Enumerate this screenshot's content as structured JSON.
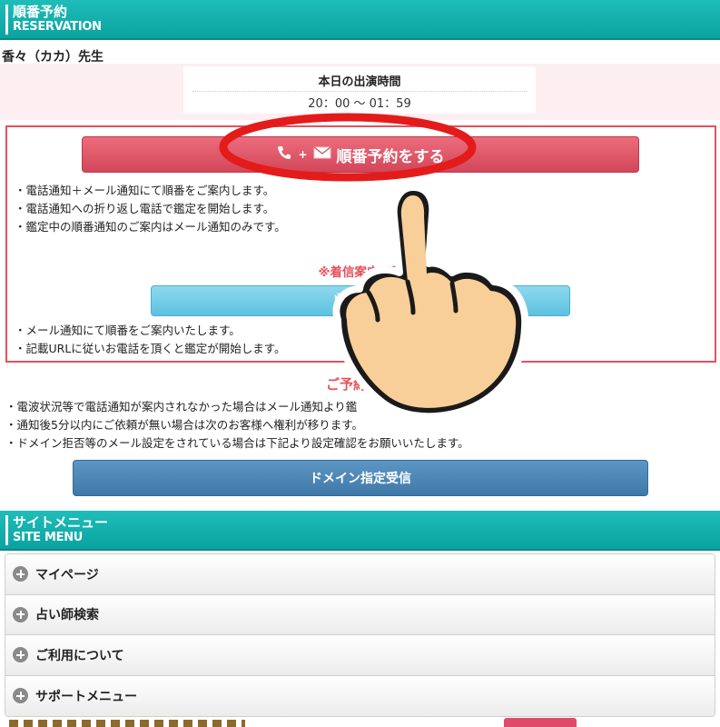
{
  "reservation": {
    "header_jp": "順番予約",
    "header_en": "RESERVATION",
    "teacher_name": "香々（カカ）先生",
    "schedule_title": "本日の出演時間",
    "schedule_time": "20：00 ～ 01：59",
    "phone_button_label": "順番予約をする",
    "phone_notes": [
      "・電話通知＋メール通知にて順番をご案内します。",
      "・電話通知への折り返し電話で鑑定を開始します。",
      "・鑑定中の順番通知のご案内はメール通知のみです。"
    ],
    "warning": "※着信案内不要",
    "mail_button_label": "順番",
    "mail_notes": [
      "・メール通知にて順番をご案内いたします。",
      "・記載URLに従いお電話を頂くと鑑定が開始します。"
    ]
  },
  "caution": {
    "title": "ご予約時の",
    "notes": [
      "・電波状況等で電話通知が案内されなかった場合はメール通知より鑑",
      "・通知後5分以内にご依頼が無い場合は次のお客様へ権利が移ります。",
      "・ドメイン拒否等のメール設定をされている場合は下記より設定確認をお願いいたします。"
    ],
    "domain_button_label": "ドメイン指定受信"
  },
  "site_menu": {
    "header_jp": "サイトメニュー",
    "header_en": "SITE MENU",
    "items": [
      {
        "label": "マイページ"
      },
      {
        "label": "占い師検索"
      },
      {
        "label": "ご利用について"
      },
      {
        "label": "サポートメニュー"
      }
    ]
  },
  "icons": {
    "phone_button": [
      "phone-icon",
      "mail-icon"
    ],
    "mail_button": "mail-icon",
    "menu_items": "plus-circle-icon",
    "overlay": [
      "highlight-circle",
      "pointing-hand"
    ]
  },
  "colors": {
    "header_teal": "#0aa3a0",
    "phone_button": "#d3475a",
    "mail_button": "#5dc2e0",
    "domain_button": "#3f79a9",
    "accent_red": "#e8505b",
    "highlight_circle": "#e41b1b",
    "hand_skin": "#f8cf98"
  }
}
